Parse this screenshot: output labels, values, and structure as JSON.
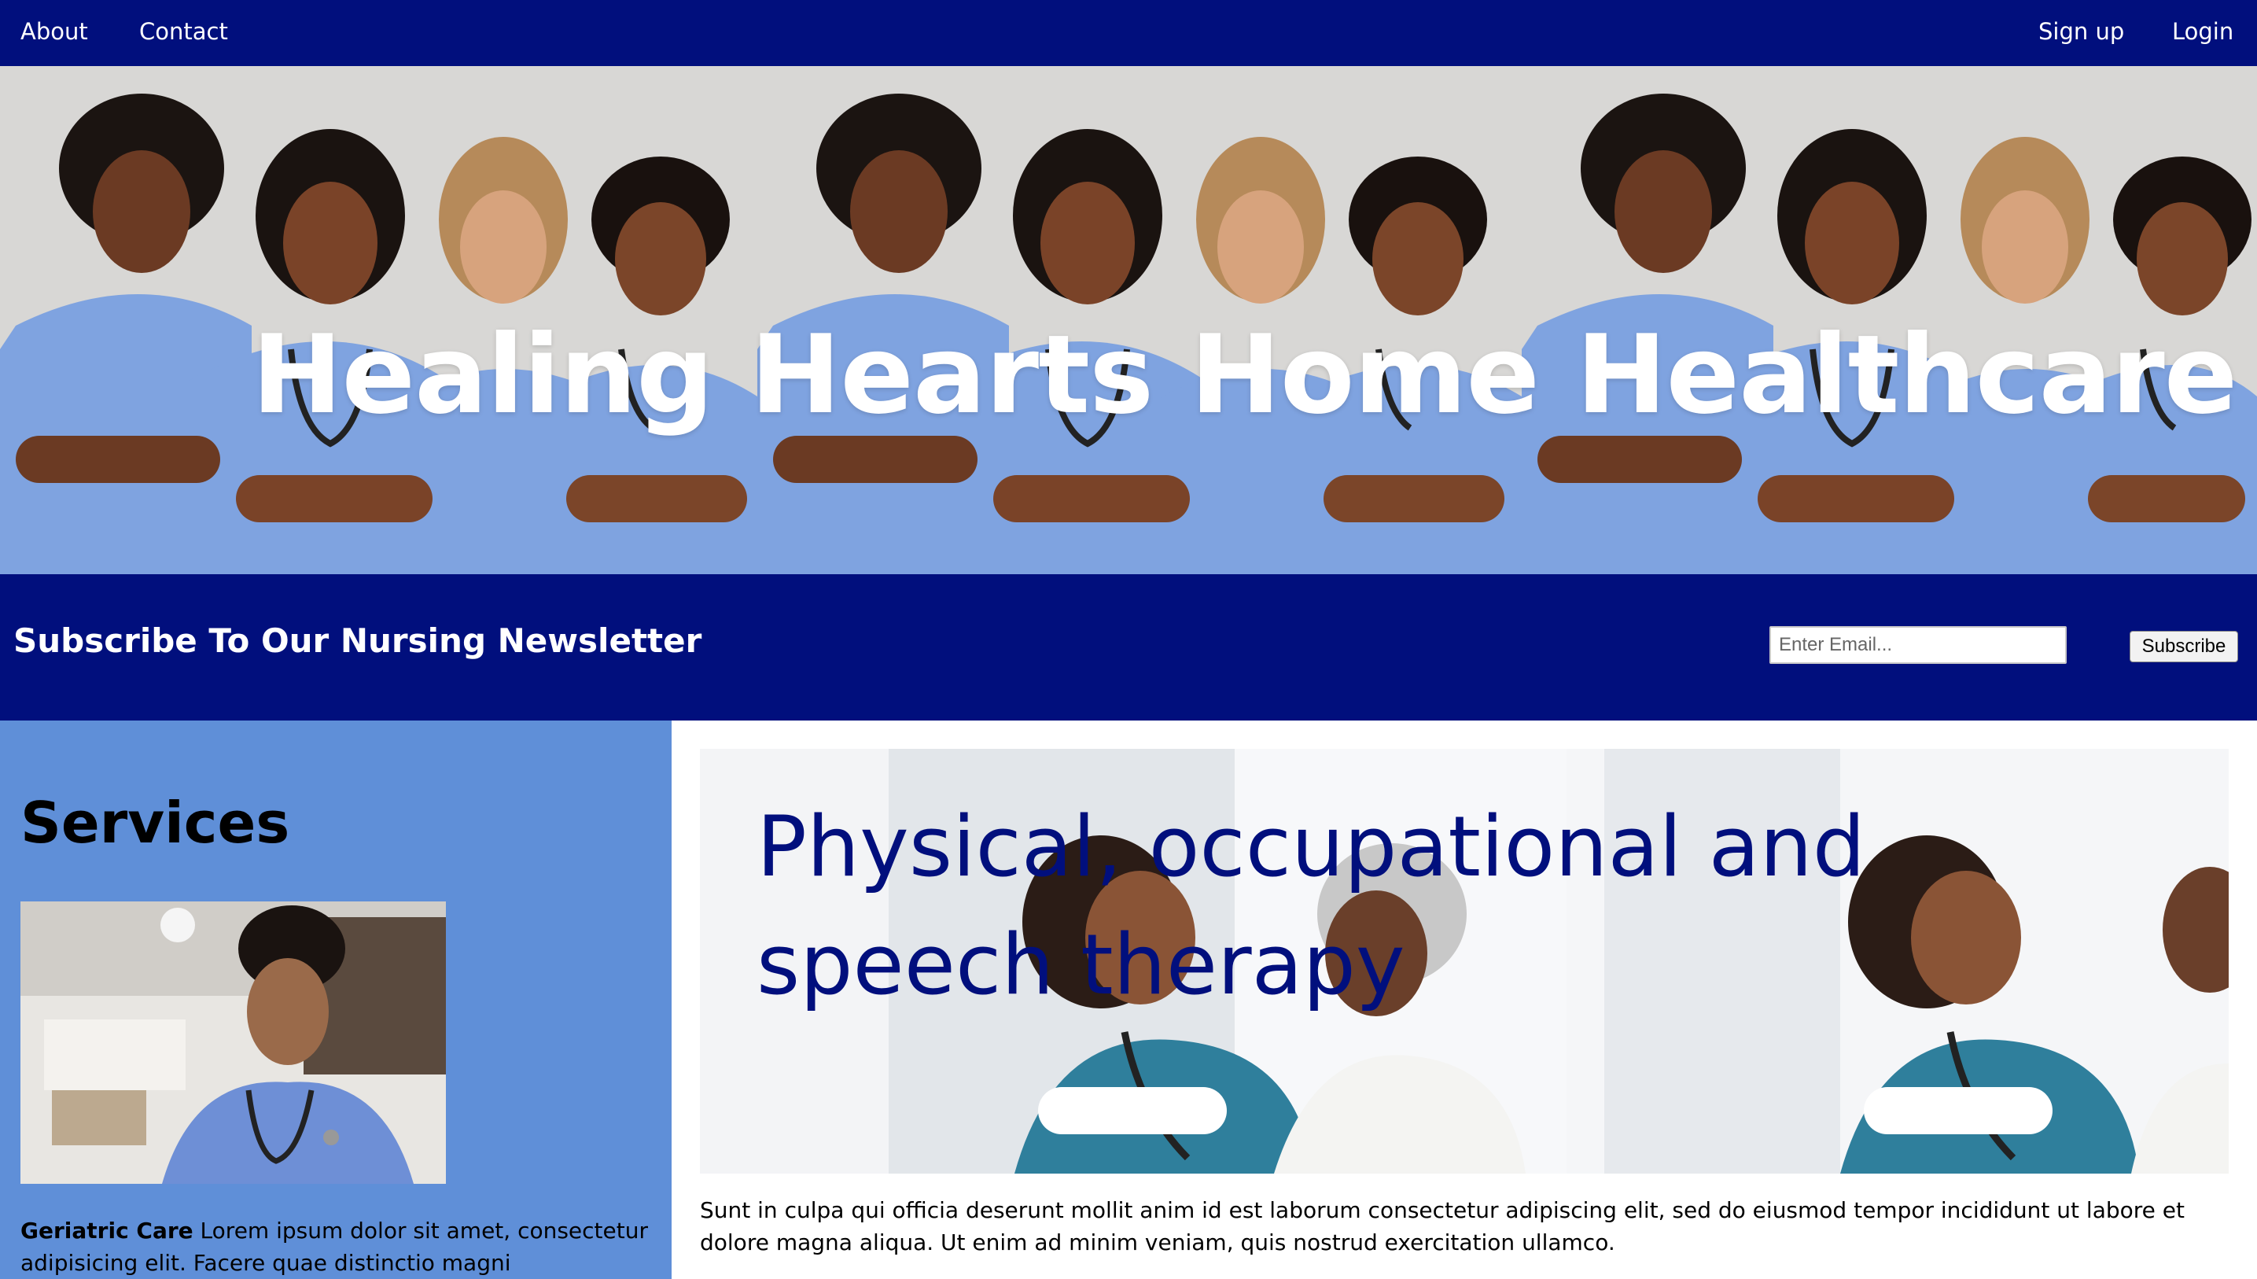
{
  "nav": {
    "about": "About",
    "contact": "Contact",
    "signup": "Sign up",
    "login": "Login"
  },
  "hero": {
    "title": "Healing Hearts Home Healthcare"
  },
  "newsletter": {
    "heading": "Subscribe To Our Nursing Newsletter",
    "email_placeholder": "Enter Email...",
    "subscribe_label": "Subscribe"
  },
  "services": {
    "heading": "Services",
    "item_title": "Geriatric Care",
    "item_text": " Lorem ipsum dolor sit amet, consectetur adipisicing elit. Facere quae distinctio magni recusandae,"
  },
  "therapy": {
    "title": "Physical, occupational and speech therapy",
    "text": "Sunt in culpa qui officia deserunt mollit anim id est laborum consectetur adipiscing elit, sed do eiusmod tempor incididunt ut labore et dolore magna aliqua. Ut enim ad minim veniam, quis nostrud exercitation ullamco."
  },
  "colors": {
    "nav_bg": "#010f7d",
    "services_bg": "#5f8fd8",
    "scrubs": "#7fa3e0",
    "title_blue": "#010f7d"
  }
}
